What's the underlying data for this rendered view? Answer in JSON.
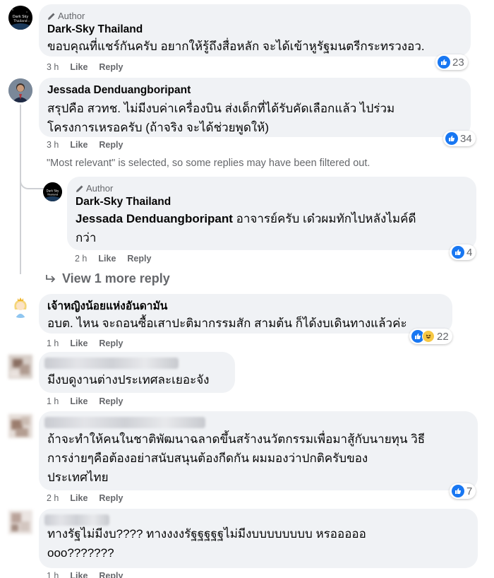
{
  "comments": [
    {
      "author_tag": "Author",
      "name": "Dark-Sky Thailand",
      "avatar_text": "Dark Sky Thailand",
      "text": "ขอบคุณที่แชร์กันครับ อยากให้รู้ถึงสื่อหลัก จะได้เข้าหูรัฐมนตรีกระทรวงอว.",
      "time": "3 h",
      "like_label": "Like",
      "reply_label": "Reply",
      "reaction_count": "23"
    },
    {
      "name": "Jessada Denduangboripant",
      "text_line1": "สรุปคือ สวทช. ไม่มีงบค่าเครื่องบิน ส่งเด็กที่ได้รับคัดเลือกแล้ว ไปร่วม",
      "text_line2": "โครงการเหรอครับ (ถ้าจริง จะได้ช่วยพูดให้)",
      "time": "3 h",
      "like_label": "Like",
      "reply_label": "Reply",
      "reaction_count": "34"
    },
    {
      "author_tag": "Author",
      "name": "Dark-Sky Thailand",
      "avatar_text": "Dark Sky Thailand",
      "mention": "Jessada Denduangboripant",
      "text_line1": " อาจารย์ครับ เด๋วผมทักไปหลังไมค์ดี",
      "text_line2": "กว่า",
      "time": "2 h",
      "like_label": "Like",
      "reply_label": "Reply",
      "reaction_count": "4"
    },
    {
      "name": "เจ้าหญิงน้อยแห่งอันดามัน",
      "text": "อบต. ไหน จะถอนซื้อเสาปะติมากรรมสัก สามต้น ก็ได้งบเดินทางแล้วค่ะ",
      "time": "1 h",
      "like_label": "Like",
      "reply_label": "Reply",
      "reaction_count": "22"
    },
    {
      "text": "มีงบดูงานต่างประเทศละเยอะจัง",
      "time": "1 h",
      "like_label": "Like",
      "reply_label": "Reply"
    },
    {
      "text_line1": "ถ้าจะทำให้คนในชาติพัฒนาฉลาดขึ้นสร้างนวัตกรรมเพื่อมาสู้กับนายทุน วิธี",
      "text_line2": "การง่ายๆคือต้องอย่าสนับสนุนต้องกีดกัน ผมมองว่าปกติครับของ",
      "text_line3": "ประเทศไทย",
      "time": "2 h",
      "like_label": "Like",
      "reply_label": "Reply",
      "reaction_count": "7"
    },
    {
      "text_line1": "ทางรัฐไม่มีงบ???? ทางงงงรัฐฐฐฐฐไม่มีงบบบบบบบบ หรอออออ",
      "text_line2": "ooo???????",
      "time": "1 h",
      "like_label": "Like",
      "reply_label": "Reply"
    }
  ],
  "filter_notice": "\"Most relevant\" is selected, so some replies may have been filtered out.",
  "view_more_replies": "View 1 more reply",
  "colors": {
    "like_blue": "#1877f2",
    "bubble_bg": "#f0f2f5",
    "meta_gray": "#65676b"
  },
  "icons": [
    "pencil-icon",
    "like-reaction-icon",
    "haha-reaction-icon",
    "reply-arrow-icon"
  ]
}
